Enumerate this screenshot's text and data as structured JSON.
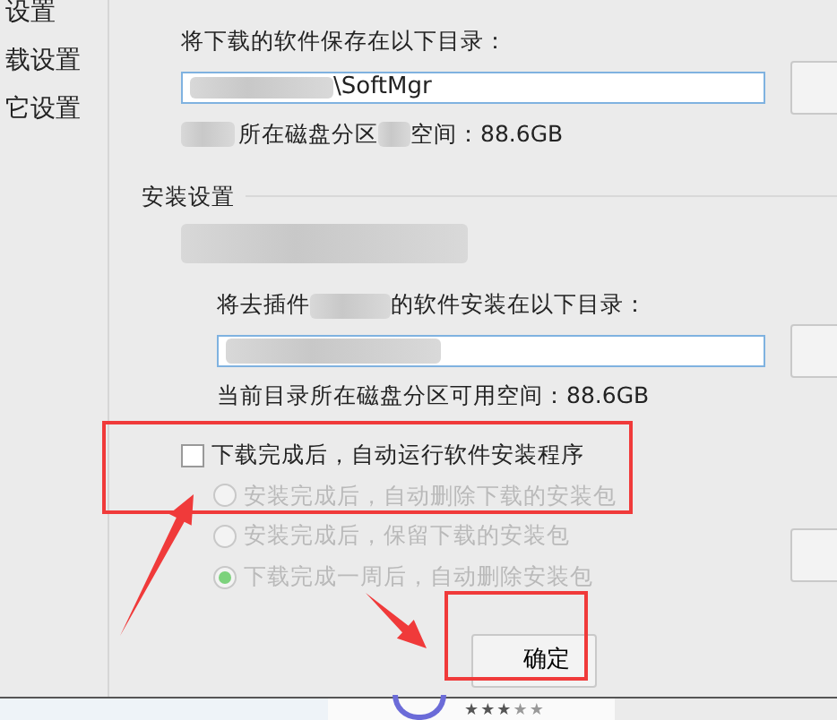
{
  "sidebar": {
    "items": [
      {
        "label": "设置"
      },
      {
        "label": "载设置"
      },
      {
        "label": "它设置"
      }
    ]
  },
  "download": {
    "label": "将下载的软件保存在以下目录：",
    "path": "\\SoftMgr",
    "free_space": [
      "所在磁盘分区",
      "空间：88.6GB"
    ]
  },
  "install": {
    "title": "安装设置",
    "dir_label": [
      "将去插件",
      "的软件安装在以下目录："
    ],
    "free_space": "当前目录所在磁盘分区可用空间：88.6GB",
    "auto_run": {
      "label": "下载完成后，自动运行软件安装程序",
      "checked": false
    },
    "after_install": [
      {
        "label": "安装完成后，自动删除下载的安装包",
        "selected": false,
        "disabled": true
      },
      {
        "label": "安装完成后，保留下载的安装包",
        "selected": false,
        "disabled": true
      },
      {
        "label": "下载完成一周后，自动删除安装包",
        "selected": true,
        "disabled": true
      }
    ]
  },
  "ok_button": "确定",
  "bottom_strip": {
    "stars": 3
  },
  "annotations": [
    {
      "kind": "frame"
    },
    {
      "kind": "frame"
    },
    {
      "kind": "arrow"
    },
    {
      "kind": "arrow"
    }
  ]
}
